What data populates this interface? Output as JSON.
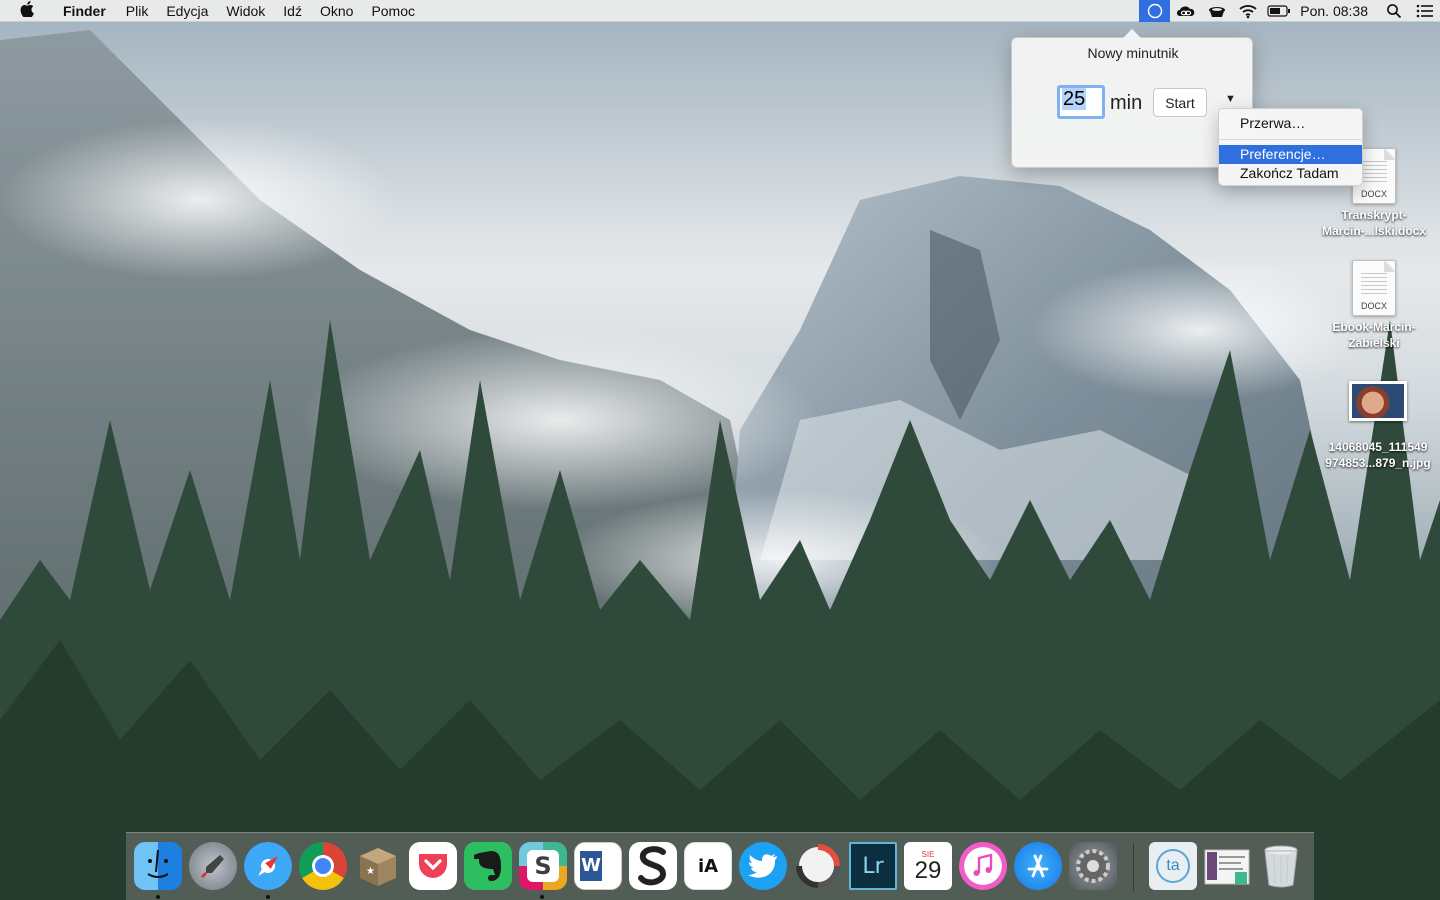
{
  "menubar": {
    "apple_icon": "apple-icon",
    "app_name": "Finder",
    "menus": [
      "Plik",
      "Edycja",
      "Widok",
      "Idź",
      "Okno",
      "Pomoc"
    ],
    "status_icons": [
      "tadam-timer-icon",
      "creative-cloud-icon",
      "caffeine-cup-icon",
      "wifi-icon",
      "battery-icon"
    ],
    "clock": "Pon. 08:38",
    "spotlight_icon": "search-icon",
    "notification_icon": "notification-center-icon"
  },
  "popover": {
    "title": "Nowy minutnik",
    "minutes_value": "25",
    "minutes_unit": "min",
    "start_label": "Start",
    "dropdown_icon": "triangle-down-icon"
  },
  "context_menu": {
    "items": [
      "Przerwa…",
      "Preferencje…",
      "Zakończ Tadam"
    ],
    "highlighted": "Preferencje…"
  },
  "desktop_icons": [
    {
      "type": "docx",
      "ext": "DOCX",
      "label_line1": "Transkrypt-",
      "label_line2": "Marcin-...lski.docx"
    },
    {
      "type": "docx",
      "ext": "DOCX",
      "label_line1": "Ebook-Marcin-",
      "label_line2": "Zabielski"
    },
    {
      "type": "jpg",
      "label_line1": "14068045_111549",
      "label_line2": "974853...879_n.jpg"
    }
  ],
  "dock": {
    "apps": [
      {
        "name": "finder-icon",
        "running": true
      },
      {
        "name": "launchpad-icon",
        "running": false
      },
      {
        "name": "safari-icon",
        "running": true
      },
      {
        "name": "chrome-icon",
        "running": false
      },
      {
        "name": "archive-box-icon",
        "running": false
      },
      {
        "name": "pocket-icon",
        "running": false
      },
      {
        "name": "evernote-icon",
        "running": false
      },
      {
        "name": "slack-icon",
        "running": true
      },
      {
        "name": "word-icon",
        "running": false
      },
      {
        "name": "scrivener-icon",
        "running": false
      },
      {
        "name": "ia-writer-icon",
        "running": false
      },
      {
        "name": "twitter-icon",
        "running": false
      },
      {
        "name": "focus-timer-icon",
        "running": false
      },
      {
        "name": "lightroom-icon",
        "running": false
      },
      {
        "name": "calendar-icon",
        "running": false
      },
      {
        "name": "itunes-icon",
        "running": false
      },
      {
        "name": "app-store-icon",
        "running": false
      },
      {
        "name": "system-preferences-icon",
        "running": false
      },
      {
        "name": "texts-folder-icon",
        "running": false
      },
      {
        "name": "screenshot-stack-icon",
        "running": false
      },
      {
        "name": "trash-icon",
        "running": false
      }
    ],
    "word_letter": "W",
    "ia_label": "iA",
    "lightroom_label": "Lr",
    "calendar_month": "SIE",
    "calendar_day": "29",
    "texts_label": "ta"
  }
}
